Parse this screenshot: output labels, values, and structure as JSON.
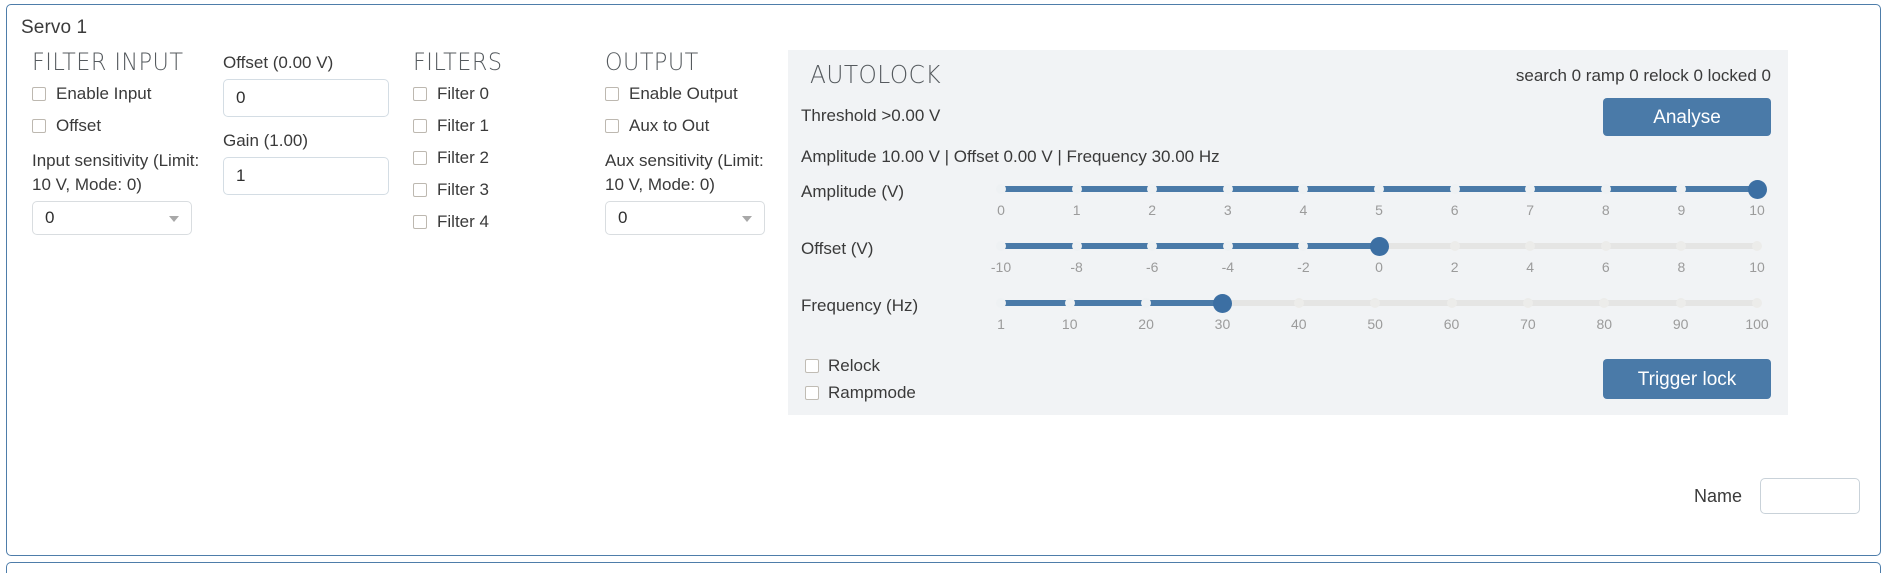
{
  "panel": {
    "title": "Servo 1"
  },
  "filter_input": {
    "heading": "FILTER INPUT",
    "enable_input_label": "Enable Input",
    "offset_label": "Offset",
    "sensitivity_label": "Input sensitivity (Limit: 10 V, Mode: 0)",
    "sensitivity_value": "0"
  },
  "offset_gain": {
    "offset_label": "Offset (0.00 V)",
    "offset_value": "0",
    "gain_label": "Gain (1.00)",
    "gain_value": "1"
  },
  "filters": {
    "heading": "FILTERS",
    "items": [
      {
        "label": "Filter 0",
        "checked": false
      },
      {
        "label": "Filter 1",
        "checked": false
      },
      {
        "label": "Filter 2",
        "checked": false
      },
      {
        "label": "Filter 3",
        "checked": false
      },
      {
        "label": "Filter 4",
        "checked": false
      }
    ]
  },
  "output": {
    "heading": "OUTPUT",
    "enable_output_label": "Enable Output",
    "aux_to_out_label": "Aux to Out",
    "aux_sensitivity_label": "Aux sensitivity (Limit: 10 V, Mode: 0)",
    "aux_sensitivity_value": "0"
  },
  "autolock": {
    "heading": "AUTOLOCK",
    "status": "search 0 ramp 0 relock 0 locked 0",
    "threshold": "Threshold >0.00 V",
    "summary": "Amplitude 10.00 V | Offset 0.00 V | Frequency 30.00 Hz",
    "analyse_label": "Analyse",
    "trigger_lock_label": "Trigger lock",
    "relock_label": "Relock",
    "rampmode_label": "Rampmode",
    "accent_color": "#4a7aa8",
    "panel_bg": "#f1f3f5",
    "sliders": [
      {
        "name": "amplitude",
        "label": "Amplitude (V)",
        "min": 0,
        "max": 10,
        "value": 10,
        "ticks": [
          "0",
          "1",
          "2",
          "3",
          "4",
          "5",
          "6",
          "7",
          "8",
          "9",
          "10"
        ],
        "tick_values": [
          0,
          1,
          2,
          3,
          4,
          5,
          6,
          7,
          8,
          9,
          10
        ]
      },
      {
        "name": "offset",
        "label": "Offset (V)",
        "min": -10,
        "max": 10,
        "value": 0,
        "ticks": [
          "-10",
          "-8",
          "-6",
          "-4",
          "-2",
          "0",
          "2",
          "4",
          "6",
          "8",
          "10"
        ],
        "tick_values": [
          -10,
          -8,
          -6,
          -4,
          -2,
          0,
          2,
          4,
          6,
          8,
          10
        ]
      },
      {
        "name": "frequency",
        "label": "Frequency (Hz)",
        "min": 1,
        "max": 100,
        "value": 30,
        "ticks": [
          "1",
          "10",
          "20",
          "30",
          "40",
          "50",
          "60",
          "70",
          "80",
          "90",
          "100"
        ],
        "tick_values": [
          1,
          10,
          20,
          30,
          40,
          50,
          60,
          70,
          80,
          90,
          100
        ]
      }
    ]
  },
  "name_field": {
    "label": "Name",
    "value": "",
    "placeholder": ""
  }
}
